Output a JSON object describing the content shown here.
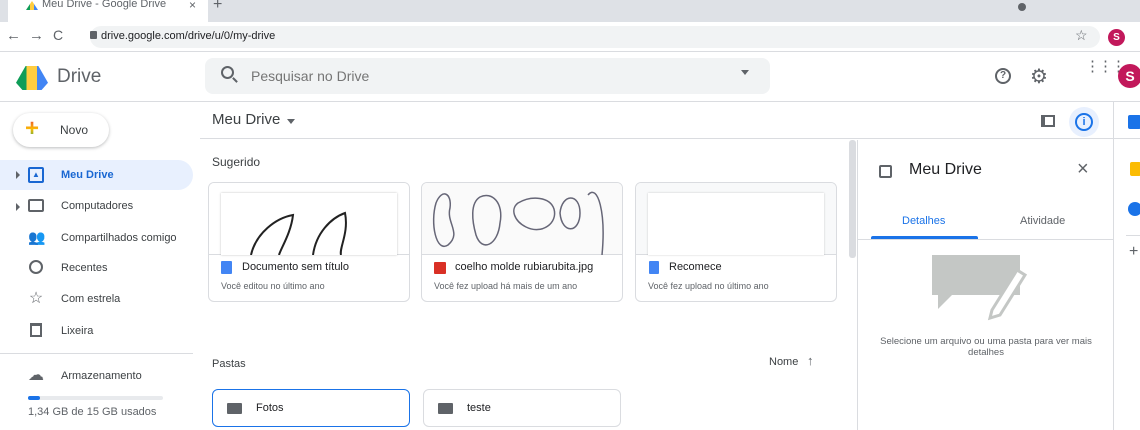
{
  "browser": {
    "tab_title": "Meu Drive - Google Drive",
    "url": "drive.google.com/drive/u/0/my-drive",
    "profile_initial": "S"
  },
  "app": {
    "name": "Drive",
    "search_placeholder": "Pesquisar no Drive",
    "avatar_initial": "S"
  },
  "sidebar": {
    "new_label": "Novo",
    "items": [
      {
        "label": "Meu Drive",
        "icon": "my-drive-icon"
      },
      {
        "label": "Computadores",
        "icon": "computer-icon"
      },
      {
        "label": "Compartilhados comigo",
        "icon": "people-icon"
      },
      {
        "label": "Recentes",
        "icon": "clock-icon"
      },
      {
        "label": "Com estrela",
        "icon": "star-icon"
      },
      {
        "label": "Lixeira",
        "icon": "trash-icon"
      }
    ],
    "storage_label": "Armazenamento",
    "storage_used": "1,34 GB de 15 GB usados",
    "storage_fraction": 0.09
  },
  "main": {
    "title": "Meu Drive",
    "suggested_heading": "Sugerido",
    "suggested": [
      {
        "name": "Documento sem título",
        "subtitle": "Você editou no último ano",
        "icon": "docs-icon",
        "color": "#4285f4"
      },
      {
        "name": "coelho molde rubiarubita.jpg",
        "subtitle": "Você fez upload há mais de um ano",
        "icon": "image-icon",
        "color": "#d93025"
      },
      {
        "name": "Recomece",
        "subtitle": "Você fez upload no último ano",
        "icon": "file-icon",
        "color": "#4285f4"
      }
    ],
    "folders_heading": "Pastas",
    "sort_label": "Nome",
    "folders": [
      {
        "name": "Fotos"
      },
      {
        "name": "teste"
      }
    ]
  },
  "details": {
    "title": "Meu Drive",
    "tabs": [
      "Detalhes",
      "Atividade"
    ],
    "empty_message": "Selecione um arquivo ou uma pasta para ver mais detalhes"
  },
  "colors": {
    "accent": "#1a73e8",
    "active_bg": "#e8f0fe"
  }
}
